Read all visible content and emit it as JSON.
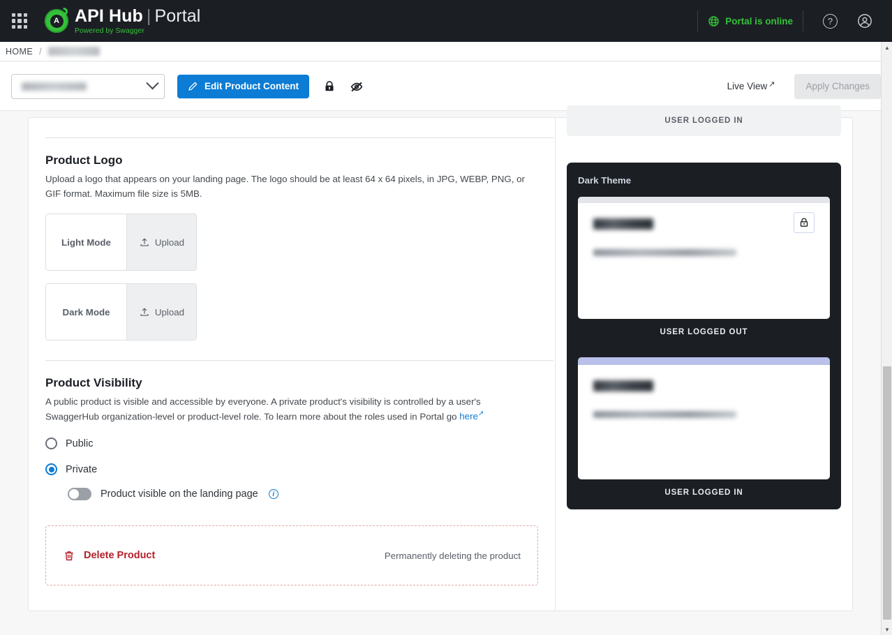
{
  "topnav": {
    "apps_icon": "apps-grid-icon",
    "brand_primary": "API Hub",
    "brand_separator": "|",
    "brand_secondary": "Portal",
    "brand_tagline_prefix": "Powered by ",
    "brand_tagline_brand": "Swagger",
    "brand_mark_letter": "A",
    "status_label": "Portal is online",
    "status_color": "#35c13a",
    "globe_icon": "globe-icon",
    "help_icon": "help-circle-icon",
    "help_glyph": "?",
    "account_icon": "account-circle-icon"
  },
  "breadcrumb": {
    "home": "HOME",
    "separator": "/",
    "current": ""
  },
  "toolbar": {
    "product_select_value": "",
    "chevron_icon": "chevron-down-icon",
    "edit_button": "Edit Product Content",
    "edit_icon": "pencil-icon",
    "lock_icon": "lock-closed-icon",
    "hidden_icon": "eye-off-icon",
    "live_view": "Live View",
    "live_view_arrow": "↗",
    "apply_changes": "Apply Changes",
    "apply_changes_enabled": false,
    "primary_color": "#0c7cd5"
  },
  "product_logo": {
    "title": "Product Logo",
    "description": "Upload a logo that appears on your landing page. The logo should be at least 64 x 64 pixels, in JPG, WEBP, PNG, or GIF format. Maximum file size is 5MB.",
    "rows": [
      {
        "label": "Light Mode",
        "upload": "Upload",
        "icon": "upload-icon"
      },
      {
        "label": "Dark Mode",
        "upload": "Upload",
        "icon": "upload-icon"
      }
    ]
  },
  "product_visibility": {
    "title": "Product Visibility",
    "description_before_link": "A public product is visible and accessible by everyone. A private product's visibility is controlled by a user's SwaggerHub organization-level or product-level role. To learn more about the roles used in Portal go ",
    "link_text": "here",
    "link_arrow": "↗",
    "options": [
      {
        "label": "Public",
        "selected": false
      },
      {
        "label": "Private",
        "selected": true
      }
    ],
    "toggle": {
      "label": "Product visible on the landing page",
      "checked": false,
      "info_icon": "info-circle-icon",
      "info_glyph": "i"
    }
  },
  "danger_zone": {
    "action_label": "Delete Product",
    "trash_icon": "trash-icon",
    "note": "Permanently deleting the product",
    "accent_color": "#b4202a"
  },
  "preview": {
    "light_caption": "USER LOGGED IN",
    "dark_theme_title": "Dark Theme",
    "dark_cards": [
      {
        "caption": "USER LOGGED OUT",
        "bar_accent": false,
        "has_lock": true,
        "lock_icon": "lock-closed-icon",
        "product_name": "",
        "product_description": ""
      },
      {
        "caption": "USER LOGGED IN",
        "bar_accent": true,
        "accent_color": "#b9c0ea",
        "has_lock": false,
        "product_name": "",
        "product_description": ""
      }
    ]
  },
  "scrollbar": {
    "up_glyph": "▲",
    "down_glyph": "▼"
  }
}
